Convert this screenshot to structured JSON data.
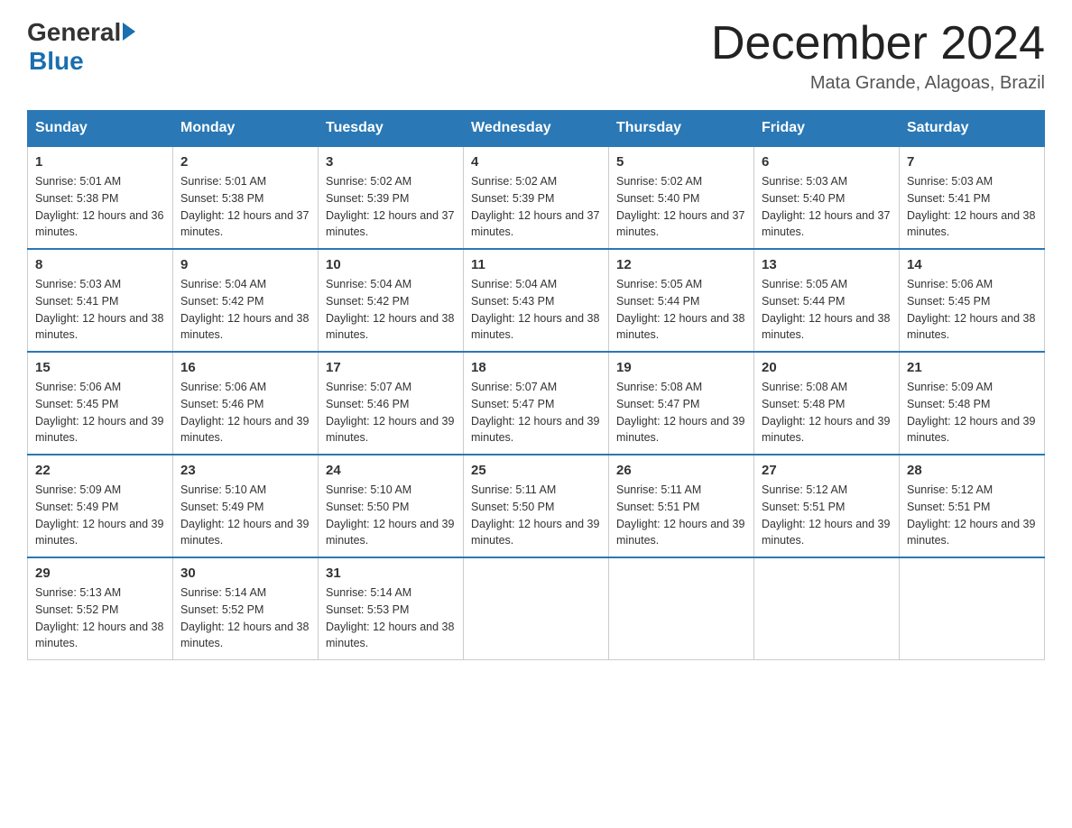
{
  "logo": {
    "text_general": "General",
    "text_blue": "Blue",
    "triangle": "▶"
  },
  "title": "December 2024",
  "subtitle": "Mata Grande, Alagoas, Brazil",
  "headers": [
    "Sunday",
    "Monday",
    "Tuesday",
    "Wednesday",
    "Thursday",
    "Friday",
    "Saturday"
  ],
  "weeks": [
    [
      {
        "day": "1",
        "sunrise": "5:01 AM",
        "sunset": "5:38 PM",
        "daylight": "12 hours and 36 minutes."
      },
      {
        "day": "2",
        "sunrise": "5:01 AM",
        "sunset": "5:38 PM",
        "daylight": "12 hours and 37 minutes."
      },
      {
        "day": "3",
        "sunrise": "5:02 AM",
        "sunset": "5:39 PM",
        "daylight": "12 hours and 37 minutes."
      },
      {
        "day": "4",
        "sunrise": "5:02 AM",
        "sunset": "5:39 PM",
        "daylight": "12 hours and 37 minutes."
      },
      {
        "day": "5",
        "sunrise": "5:02 AM",
        "sunset": "5:40 PM",
        "daylight": "12 hours and 37 minutes."
      },
      {
        "day": "6",
        "sunrise": "5:03 AM",
        "sunset": "5:40 PM",
        "daylight": "12 hours and 37 minutes."
      },
      {
        "day": "7",
        "sunrise": "5:03 AM",
        "sunset": "5:41 PM",
        "daylight": "12 hours and 38 minutes."
      }
    ],
    [
      {
        "day": "8",
        "sunrise": "5:03 AM",
        "sunset": "5:41 PM",
        "daylight": "12 hours and 38 minutes."
      },
      {
        "day": "9",
        "sunrise": "5:04 AM",
        "sunset": "5:42 PM",
        "daylight": "12 hours and 38 minutes."
      },
      {
        "day": "10",
        "sunrise": "5:04 AM",
        "sunset": "5:42 PM",
        "daylight": "12 hours and 38 minutes."
      },
      {
        "day": "11",
        "sunrise": "5:04 AM",
        "sunset": "5:43 PM",
        "daylight": "12 hours and 38 minutes."
      },
      {
        "day": "12",
        "sunrise": "5:05 AM",
        "sunset": "5:44 PM",
        "daylight": "12 hours and 38 minutes."
      },
      {
        "day": "13",
        "sunrise": "5:05 AM",
        "sunset": "5:44 PM",
        "daylight": "12 hours and 38 minutes."
      },
      {
        "day": "14",
        "sunrise": "5:06 AM",
        "sunset": "5:45 PM",
        "daylight": "12 hours and 38 minutes."
      }
    ],
    [
      {
        "day": "15",
        "sunrise": "5:06 AM",
        "sunset": "5:45 PM",
        "daylight": "12 hours and 39 minutes."
      },
      {
        "day": "16",
        "sunrise": "5:06 AM",
        "sunset": "5:46 PM",
        "daylight": "12 hours and 39 minutes."
      },
      {
        "day": "17",
        "sunrise": "5:07 AM",
        "sunset": "5:46 PM",
        "daylight": "12 hours and 39 minutes."
      },
      {
        "day": "18",
        "sunrise": "5:07 AM",
        "sunset": "5:47 PM",
        "daylight": "12 hours and 39 minutes."
      },
      {
        "day": "19",
        "sunrise": "5:08 AM",
        "sunset": "5:47 PM",
        "daylight": "12 hours and 39 minutes."
      },
      {
        "day": "20",
        "sunrise": "5:08 AM",
        "sunset": "5:48 PM",
        "daylight": "12 hours and 39 minutes."
      },
      {
        "day": "21",
        "sunrise": "5:09 AM",
        "sunset": "5:48 PM",
        "daylight": "12 hours and 39 minutes."
      }
    ],
    [
      {
        "day": "22",
        "sunrise": "5:09 AM",
        "sunset": "5:49 PM",
        "daylight": "12 hours and 39 minutes."
      },
      {
        "day": "23",
        "sunrise": "5:10 AM",
        "sunset": "5:49 PM",
        "daylight": "12 hours and 39 minutes."
      },
      {
        "day": "24",
        "sunrise": "5:10 AM",
        "sunset": "5:50 PM",
        "daylight": "12 hours and 39 minutes."
      },
      {
        "day": "25",
        "sunrise": "5:11 AM",
        "sunset": "5:50 PM",
        "daylight": "12 hours and 39 minutes."
      },
      {
        "day": "26",
        "sunrise": "5:11 AM",
        "sunset": "5:51 PM",
        "daylight": "12 hours and 39 minutes."
      },
      {
        "day": "27",
        "sunrise": "5:12 AM",
        "sunset": "5:51 PM",
        "daylight": "12 hours and 39 minutes."
      },
      {
        "day": "28",
        "sunrise": "5:12 AM",
        "sunset": "5:51 PM",
        "daylight": "12 hours and 39 minutes."
      }
    ],
    [
      {
        "day": "29",
        "sunrise": "5:13 AM",
        "sunset": "5:52 PM",
        "daylight": "12 hours and 38 minutes."
      },
      {
        "day": "30",
        "sunrise": "5:14 AM",
        "sunset": "5:52 PM",
        "daylight": "12 hours and 38 minutes."
      },
      {
        "day": "31",
        "sunrise": "5:14 AM",
        "sunset": "5:53 PM",
        "daylight": "12 hours and 38 minutes."
      },
      null,
      null,
      null,
      null
    ]
  ]
}
